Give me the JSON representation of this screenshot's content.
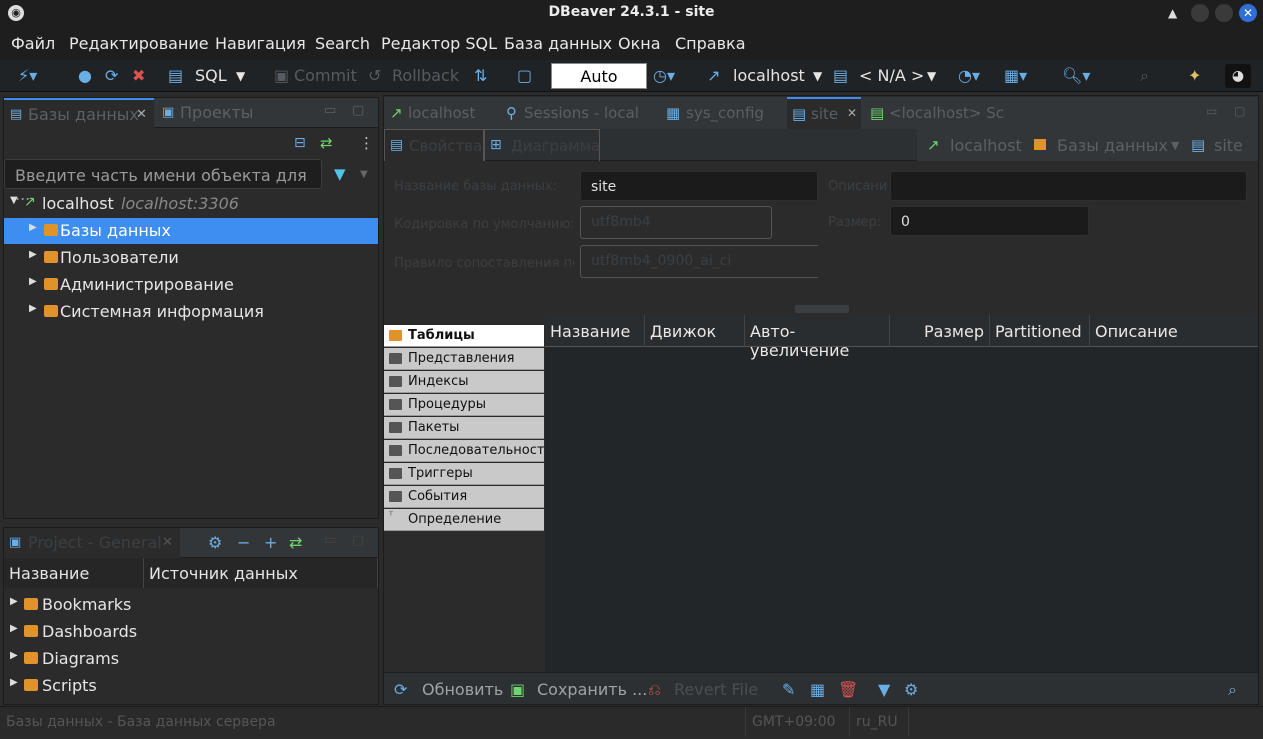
{
  "window": {
    "title": "DBeaver 24.3.1 - site"
  },
  "menu": [
    "Файл",
    "Редактирование",
    "Навигация",
    "Search",
    "Редактор SQL",
    "База данных",
    "Окна",
    "Справка"
  ],
  "toolbar": {
    "sql_label": "SQL",
    "commit_label": "Commit",
    "rollback_label": "Rollback",
    "transaction_mode": "Auto",
    "connection": "localhost",
    "schema": "< N/A >"
  },
  "navigator": {
    "tab_databases": "Базы данных",
    "tab_projects": "Проекты",
    "filter_placeholder": "Введите часть имени объекта для ...",
    "connection_name": "localhost",
    "connection_host": "localhost:3306",
    "items": [
      "Базы данных",
      "Пользователи",
      "Администрирование",
      "Системная информация"
    ]
  },
  "project": {
    "tab_label": "Project - General",
    "col_name": "Название",
    "col_source": "Источник данных",
    "items": [
      "Bookmarks",
      "Dashboards",
      "Diagrams",
      "Scripts"
    ]
  },
  "editor": {
    "tabs": [
      "localhost",
      "Sessions - local",
      "sys_config",
      "site",
      "<localhost> Sc"
    ],
    "subtab_properties": "Свойства",
    "subtab_diagram": "Диаграмма",
    "breadcrumb": [
      "localhost",
      "Базы данных",
      "site"
    ],
    "props": {
      "db_name_label": "Название базы данных:",
      "db_name_value": "site",
      "charset_label": "Кодировка по умолчанию:",
      "charset_value": "utf8mb4",
      "collation_label": "Правило сопоставления по умолчанию:",
      "collation_value": "utf8mb4_0900_ai_ci",
      "size_label": "Размер:",
      "size_value": "0",
      "desc_label": "Описание:"
    },
    "object_types": [
      "Таблицы",
      "Представления",
      "Индексы",
      "Процедуры",
      "Пакеты",
      "Последовательности",
      "Триггеры",
      "События",
      "Определение"
    ],
    "grid_columns": [
      "Название",
      "Движок",
      "Авто-увеличение",
      "Размер",
      "Partitioned",
      "Описание"
    ],
    "bottom": {
      "refresh": "Обновить",
      "save": "Сохранить ...",
      "revert": "Revert File"
    }
  },
  "status": {
    "left": "Базы данных - База данных сервера",
    "tz": "GMT+09:00",
    "locale": "ru_RU"
  },
  "colors": {
    "selection": "#3d8ef0",
    "accent": "#6aaee6",
    "folder": "#e0932a"
  }
}
